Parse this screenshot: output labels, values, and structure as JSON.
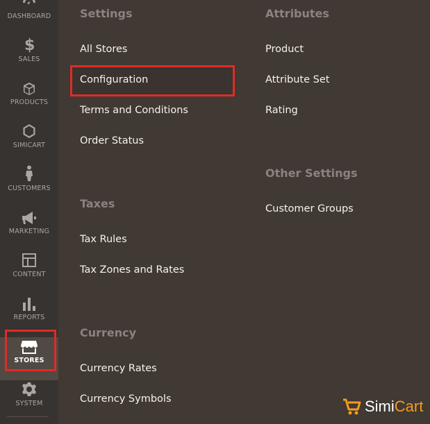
{
  "sidebar": {
    "items": [
      {
        "label": "DASHBOARD",
        "icon": "dashboard-icon"
      },
      {
        "label": "SALES",
        "icon": "dollar-icon"
      },
      {
        "label": "PRODUCTS",
        "icon": "cube-icon"
      },
      {
        "label": "SIMICART",
        "icon": "hexagon-icon"
      },
      {
        "label": "CUSTOMERS",
        "icon": "person-icon"
      },
      {
        "label": "MARKETING",
        "icon": "megaphone-icon"
      },
      {
        "label": "CONTENT",
        "icon": "layout-icon"
      },
      {
        "label": "REPORTS",
        "icon": "bar-chart-icon"
      },
      {
        "label": "STORES",
        "icon": "store-icon",
        "active": true
      },
      {
        "label": "SYSTEM",
        "icon": "gear-icon"
      }
    ]
  },
  "panel": {
    "settings": {
      "title": "Settings",
      "links": [
        "All Stores",
        "Configuration",
        "Terms and Conditions",
        "Order Status"
      ]
    },
    "taxes": {
      "title": "Taxes",
      "links": [
        "Tax Rules",
        "Tax Zones and Rates"
      ]
    },
    "currency": {
      "title": "Currency",
      "links": [
        "Currency Rates",
        "Currency Symbols"
      ]
    },
    "attributes": {
      "title": "Attributes",
      "links": [
        "Product",
        "Attribute Set",
        "Rating"
      ]
    },
    "other_settings": {
      "title": "Other Settings",
      "links": [
        "Customer Groups"
      ]
    }
  },
  "logo": {
    "part1": "Simi",
    "part2": "Cart"
  },
  "colors": {
    "highlight": "#e02b27",
    "accent": "#f79b1b",
    "panel_bg": "#403934",
    "sidebar_bg": "#373330"
  }
}
